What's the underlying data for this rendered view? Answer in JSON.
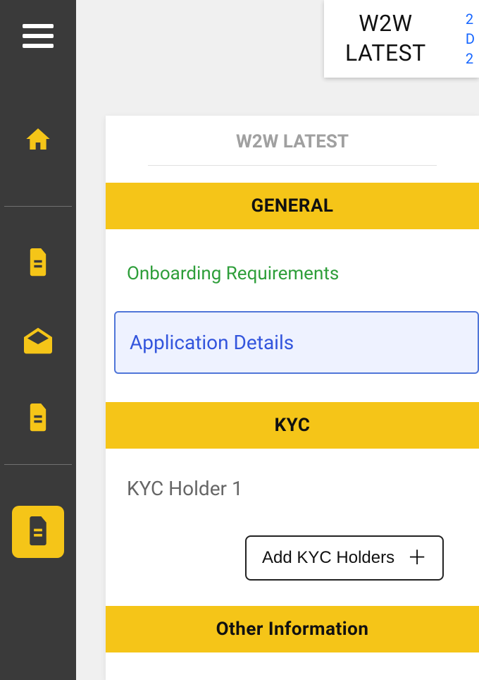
{
  "topCard": {
    "titleLine1": "W2W",
    "titleLine2": "LATEST",
    "dateFrag1": "2",
    "dateFrag2": "D",
    "dateFrag3": "2"
  },
  "panel": {
    "heading": "W2W LATEST"
  },
  "sections": {
    "general": {
      "title": "GENERAL",
      "onboarding": "Onboarding Requirements",
      "appDetails": "Application Details"
    },
    "kyc": {
      "title": "KYC",
      "holderLabel": "KYC Holder 1",
      "addButton": "Add KYC Holders"
    },
    "other": {
      "title": "Other Information"
    }
  },
  "colors": {
    "accent": "#f5c518",
    "sidebar": "#3a3a3a",
    "link": "#1565ff",
    "highlightBorder": "#5076d8",
    "highlightBg": "#eef2ff",
    "green": "#2e9e3a"
  }
}
